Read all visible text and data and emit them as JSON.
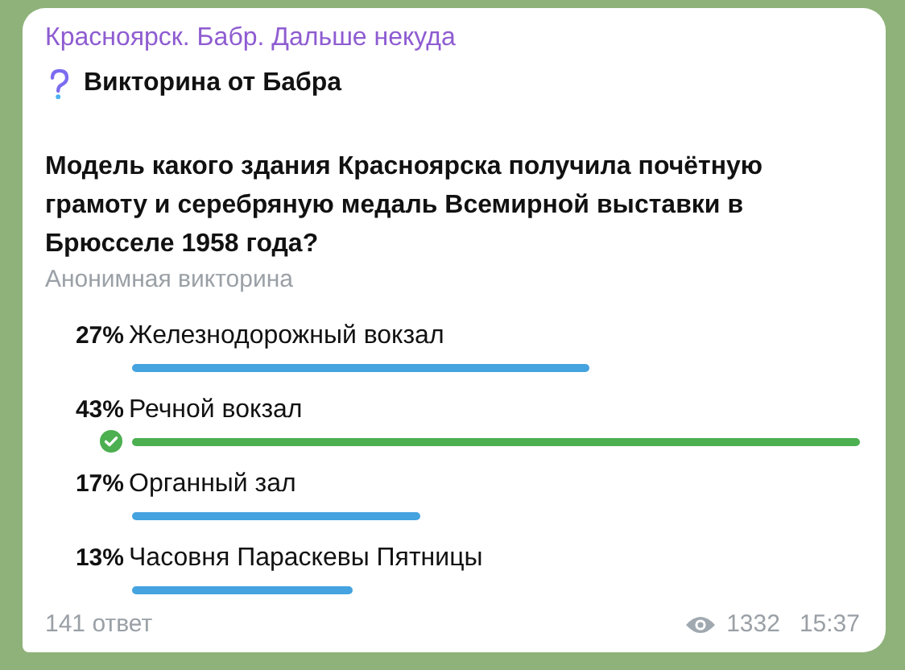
{
  "channel": {
    "name": "Красноярск. Бабр. Дальше некуда"
  },
  "poll": {
    "title": "Викторина от Бабра",
    "question": "Модель какого здания Красноярска получила почётную грамоту и серебряную медаль Всемирной выставки в Брюсселе 1958 года?",
    "type": "Анонимная викторина",
    "options": [
      {
        "percent": "27%",
        "label": "Железнодорожный вокзал",
        "correct": false
      },
      {
        "percent": "43%",
        "label": "Речной вокзал",
        "correct": true
      },
      {
        "percent": "17%",
        "label": "Органный зал",
        "correct": false
      },
      {
        "percent": "13%",
        "label": "Часовня Параскевы Пятницы",
        "correct": false
      }
    ],
    "answers": "141 ответ"
  },
  "views": "1332",
  "time": "15:37"
}
